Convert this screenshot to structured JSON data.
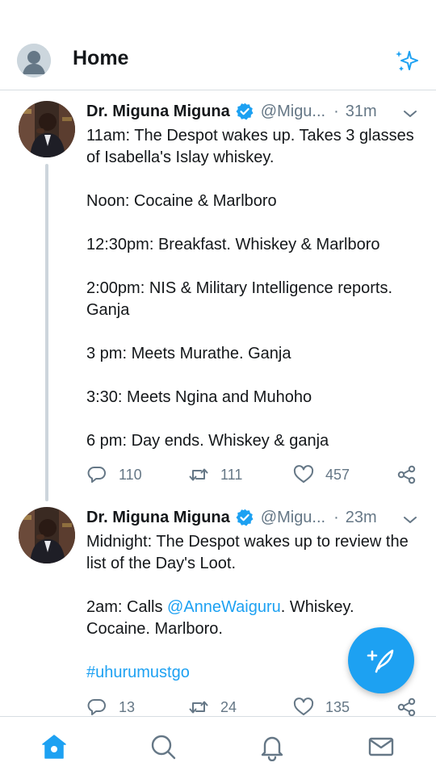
{
  "header": {
    "title": "Home",
    "avatar_icon": "default-avatar-icon",
    "action_icon": "sparkle-icon"
  },
  "colors": {
    "accent": "#1da1f2",
    "text": "#14171a",
    "muted": "#657786",
    "divider": "#d7dde2"
  },
  "tweets": [
    {
      "author": "Dr. Miguna Miguna",
      "handle": "@Migu...",
      "time": "31m",
      "lines": [
        "11am: The Despot wakes up. Takes 3 glasses of Isabella's Islay whiskey.",
        "Noon: Cocaine & Marlboro",
        "12:30pm: Breakfast. Whiskey & Marlboro",
        "2:00pm: NIS & Military Intelligence reports. Ganja",
        "3 pm: Meets Murathe. Ganja",
        "3:30: Meets Ngina and Muhoho",
        "6 pm: Day ends. Whiskey & ganja"
      ],
      "replies": "110",
      "retweets": "111",
      "likes": "457"
    },
    {
      "author": "Dr. Miguna Miguna",
      "handle": "@Migu...",
      "time": "23m",
      "line1": "Midnight: The Despot wakes up to review the list of the Day's Loot.",
      "line2_prefix": "2am: Calls ",
      "mention": "@AnneWaiguru",
      "line2_suffix": ". Whiskey. Cocaine. Marlboro.",
      "hashtag": "#uhurumustgo",
      "replies": "13",
      "retweets": "24",
      "likes": "135"
    }
  ],
  "fab": {
    "icon": "compose-tweet-icon"
  },
  "bottom_nav": [
    "home-icon",
    "search-icon",
    "notifications-icon",
    "messages-icon"
  ]
}
